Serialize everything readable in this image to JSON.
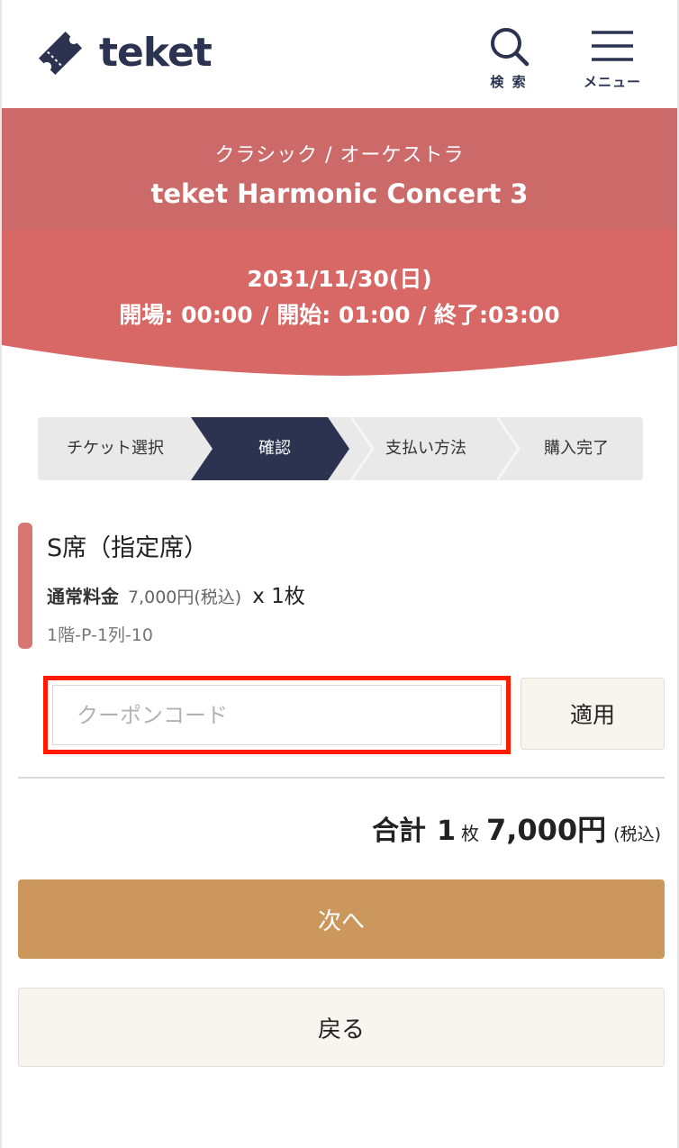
{
  "header": {
    "logo_text": "teket",
    "search_label": "検 索",
    "menu_label": "メニュー"
  },
  "event": {
    "category": "クラシック / オーケストラ",
    "title": "teket Harmonic Concert 3",
    "date": "2031/11/30(日)",
    "times": "開場: 00:00 / 開始: 01:00 / 終了:03:00"
  },
  "steps": [
    {
      "label": "チケット選択",
      "active": false
    },
    {
      "label": "確認",
      "active": true
    },
    {
      "label": "支払い方法",
      "active": false
    },
    {
      "label": "購入完了",
      "active": false
    }
  ],
  "ticket": {
    "name": "S席（指定席）",
    "price_type": "通常料金",
    "price": "7,000円(税込)",
    "quantity": "x 1枚",
    "seat": "1階-P-1列-10"
  },
  "coupon": {
    "placeholder": "クーポンコード",
    "value": "",
    "apply_label": "適用"
  },
  "total": {
    "label": "合計",
    "quantity": "1",
    "unit": "枚",
    "price": "7,000円",
    "tax_note": "(税込)"
  },
  "actions": {
    "next_label": "次へ",
    "back_label": "戻る"
  },
  "colors": {
    "brand_navy": "#2b3350",
    "hero_top": "#cb6a69",
    "hero_bottom": "#d86866",
    "ticket_accent": "#d77673",
    "highlight_outline": "#ff1a00",
    "primary_button": "#cc975c",
    "secondary_button": "#f8f4ee"
  }
}
